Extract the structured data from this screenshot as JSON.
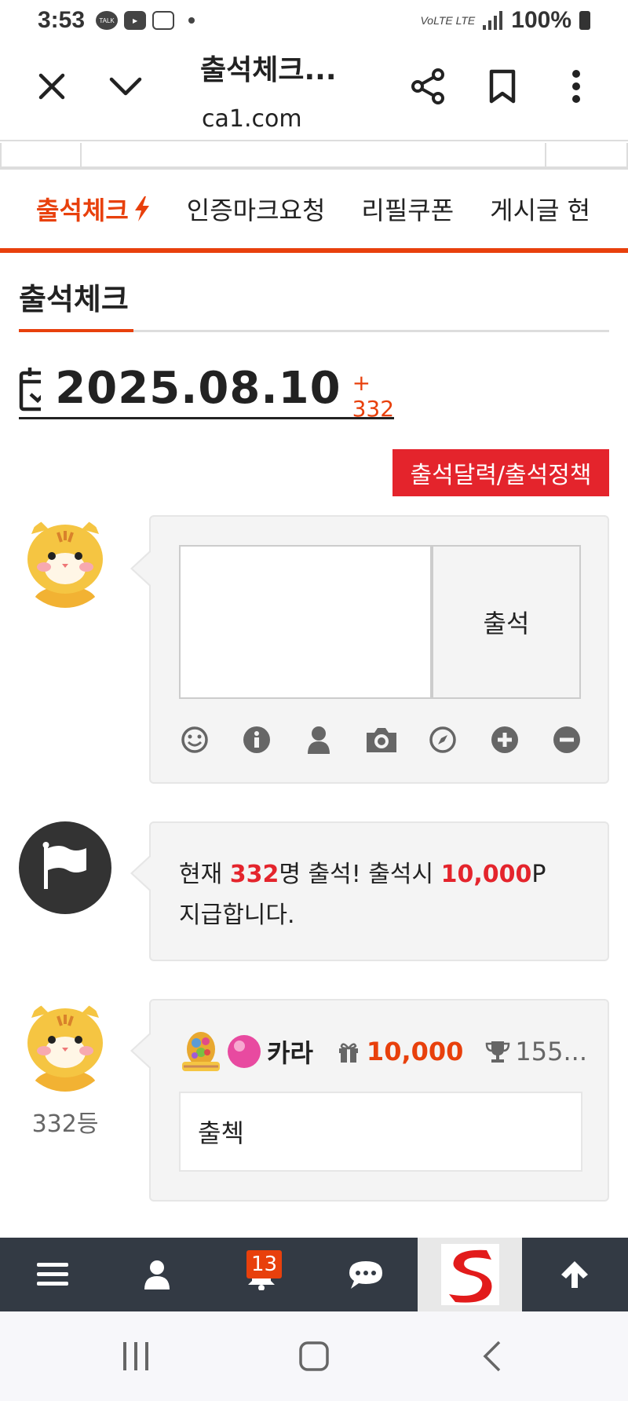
{
  "status_bar": {
    "time": "3:53",
    "network": "VoLTE LTE",
    "battery": "100%"
  },
  "browser": {
    "title": "출석체크...",
    "url": "ca1.com"
  },
  "tabs": [
    {
      "label": "출석체크",
      "active": true
    },
    {
      "label": "인증마크요청",
      "active": false
    },
    {
      "label": "리필쿠폰",
      "active": false
    },
    {
      "label": "게시글 현",
      "active": false
    }
  ],
  "section": {
    "title": "출석체크",
    "date": "2025.08.10",
    "count": "+ 332",
    "calendar_button": "출석달력/출석정책"
  },
  "form": {
    "submit_label": "출석",
    "tools": [
      "smile-icon",
      "info-icon",
      "user-icon",
      "camera-icon",
      "compass-icon",
      "plus-circle-icon",
      "minus-circle-icon"
    ]
  },
  "notice": {
    "prefix": "현재 ",
    "count": "332",
    "middle": "명 출석! 출석시 ",
    "points": "10,000",
    "suffix": "P 지급합니다."
  },
  "entry": {
    "rank": "332등",
    "username": "카라",
    "points": "10,000",
    "trophy": "155...",
    "comment": "출첵"
  },
  "app_nav": {
    "notification_count": "13"
  },
  "colors": {
    "accent": "#e8400c",
    "red": "#e4242c",
    "nav_bg": "#333a44"
  }
}
